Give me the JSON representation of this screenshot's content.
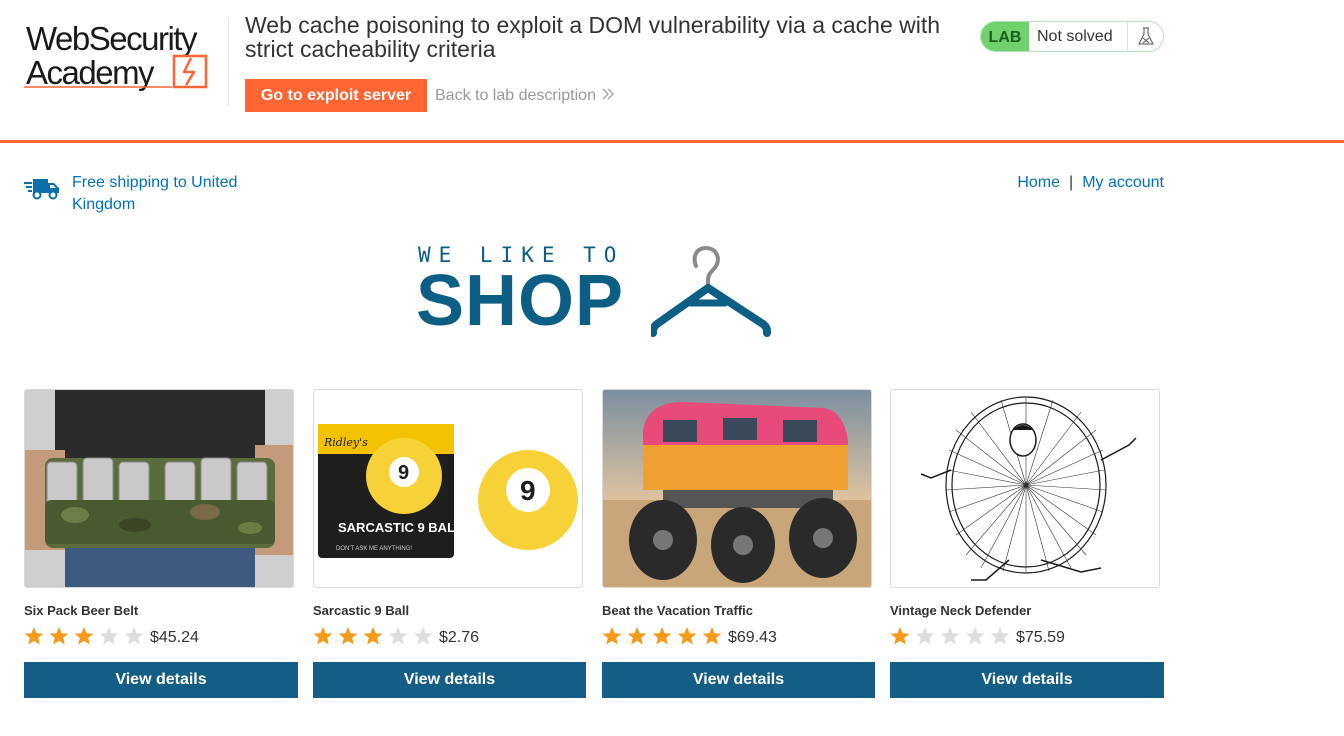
{
  "academy_header": {
    "logo_line1": "WebSecurity",
    "logo_line2": "Academy",
    "lab_title": "Web cache poisoning to exploit a DOM vulnerability via a cache with strict cacheability criteria",
    "exploit_button": "Go to exploit server",
    "back_link": "Back to lab description",
    "status_badge": "LAB",
    "status_text": "Not solved",
    "accent_color": "#ff6633",
    "status_color": "#70d16d"
  },
  "shop_nav": {
    "shipping_text": "Free shipping to United Kingdom",
    "links": [
      "Home",
      "My account"
    ],
    "separator": "|",
    "link_color": "#0071bc"
  },
  "banner": {
    "tagline": "WE LIKE TO",
    "headline": "SHOP",
    "icon": "hanger-icon",
    "color": "#0d5e85"
  },
  "products": [
    {
      "name": "Six Pack Beer Belt",
      "rating": 3,
      "price": "$45.24",
      "button": "View details",
      "image": "beer-belt-image"
    },
    {
      "name": "Sarcastic 9 Ball",
      "rating": 3,
      "price": "$2.76",
      "button": "View details",
      "image": "sarcastic-9-ball-image"
    },
    {
      "name": "Beat the Vacation Traffic",
      "rating": 5,
      "price": "$69.43",
      "button": "View details",
      "image": "monster-van-image"
    },
    {
      "name": "Vintage Neck Defender",
      "rating": 1,
      "price": "$75.59",
      "button": "View details",
      "image": "neck-defender-image"
    }
  ],
  "product_image_text": {
    "box_brand": "Ridley's",
    "box_number": "9",
    "box_title": "SARCASTIC\n9 BALL",
    "box_tagline": "DON'T ASK ME ANYTHING!",
    "ball_number": "9"
  },
  "rating_max": 5,
  "colors": {
    "star_filled": "#f59a1a",
    "star_empty": "#dddddd",
    "button": "#145e85"
  }
}
